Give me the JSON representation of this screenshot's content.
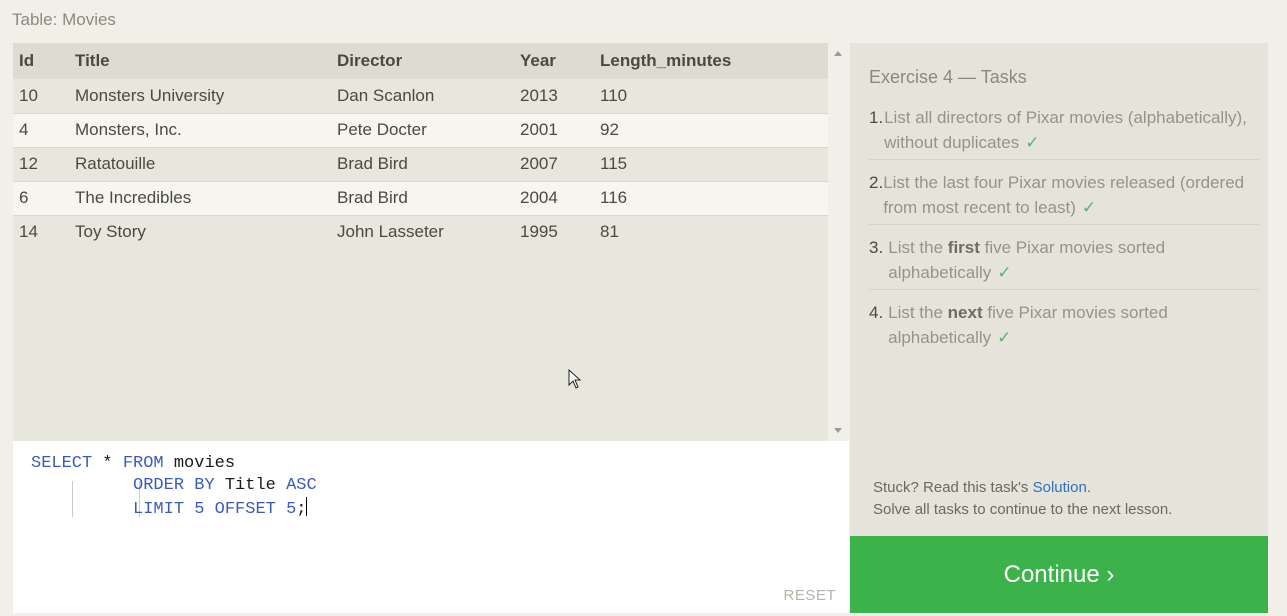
{
  "caption": "Table: Movies",
  "table": {
    "headers": [
      "Id",
      "Title",
      "Director",
      "Year",
      "Length_minutes"
    ],
    "rows": [
      [
        "10",
        "Monsters University",
        "Dan Scanlon",
        "2013",
        "110"
      ],
      [
        "4",
        "Monsters, Inc.",
        "Pete Docter",
        "2001",
        "92"
      ],
      [
        "12",
        "Ratatouille",
        "Brad Bird",
        "2007",
        "115"
      ],
      [
        "6",
        "The Incredibles",
        "Brad Bird",
        "2004",
        "116"
      ],
      [
        "14",
        "Toy Story",
        "John Lasseter",
        "1995",
        "81"
      ]
    ]
  },
  "editor": {
    "line1": {
      "kw1": "SELECT",
      "t1": " * ",
      "kw2": "FROM",
      "t2": " movies"
    },
    "line2": {
      "kw1": "ORDER BY",
      "t1": " Title ",
      "kw2": "ASC"
    },
    "line3": {
      "kw1": "LIMIT",
      "n1": "5",
      "kw2": "OFFSET",
      "n2": "5",
      "t1": ";"
    },
    "reset": "RESET"
  },
  "tasks": {
    "title": "Exercise 4 — Tasks",
    "items": [
      {
        "num": "1.",
        "pre": "List all directors of Pixar movies (alphabetically), without duplicates",
        "bold": "",
        "post": "",
        "check": "✓"
      },
      {
        "num": "2.",
        "pre": "List the last four Pixar movies released (ordered from most recent to least)",
        "bold": "",
        "post": "",
        "check": "✓"
      },
      {
        "num": "3.",
        "pre": "List the ",
        "bold": "first",
        "post": " five Pixar movies sorted alphabetically",
        "check": "✓"
      },
      {
        "num": "4.",
        "pre": "List the ",
        "bold": "next",
        "post": " five Pixar movies sorted alphabetically",
        "check": "✓"
      }
    ],
    "stuck_pre": "Stuck? Read this task's ",
    "solution_link": "Solution",
    "stuck_post": ".",
    "solve_all": "Solve all tasks to continue to the next lesson."
  },
  "continue_label": "Continue ›",
  "icons": {
    "mouse_cursor": "arrow-cursor-icon"
  }
}
